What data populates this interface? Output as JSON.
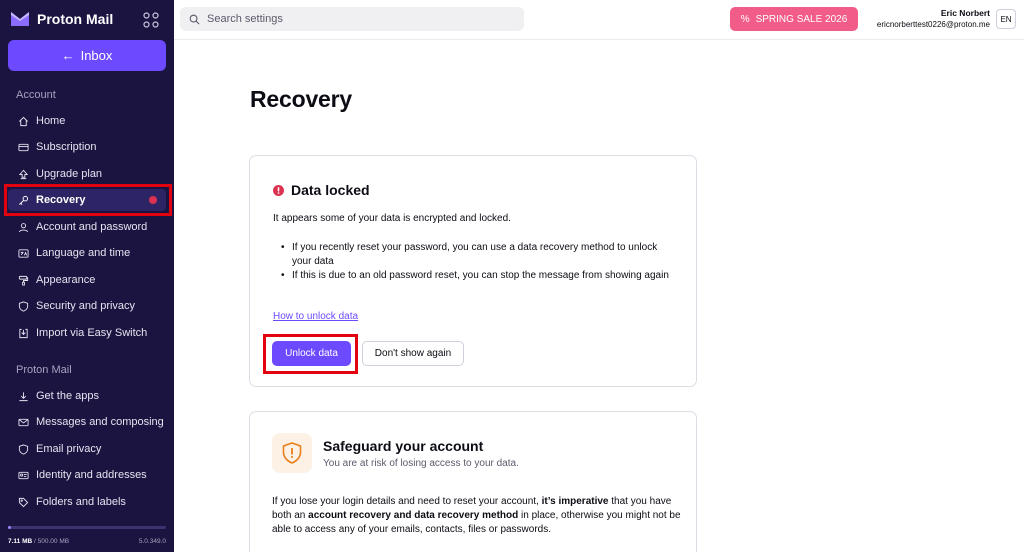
{
  "brand": {
    "name": "Proton Mail"
  },
  "sidebar": {
    "inbox_label": "Inbox",
    "section_account": "Account",
    "account_items": [
      {
        "label": "Home",
        "icon": "home-icon"
      },
      {
        "label": "Subscription",
        "icon": "credit-card-icon"
      },
      {
        "label": "Upgrade plan",
        "icon": "upgrade-arrow-icon"
      },
      {
        "label": "Recovery",
        "icon": "key-icon",
        "active": true,
        "dot": true
      },
      {
        "label": "Account and password",
        "icon": "user-icon"
      },
      {
        "label": "Language and time",
        "icon": "language-icon"
      },
      {
        "label": "Appearance",
        "icon": "paint-roller-icon"
      },
      {
        "label": "Security and privacy",
        "icon": "shield-icon"
      },
      {
        "label": "Import via Easy Switch",
        "icon": "import-icon"
      }
    ],
    "section_mail": "Proton Mail",
    "mail_items": [
      {
        "label": "Get the apps",
        "icon": "download-icon"
      },
      {
        "label": "Messages and composing",
        "icon": "envelope-icon"
      },
      {
        "label": "Email privacy",
        "icon": "shield-icon"
      },
      {
        "label": "Identity and addresses",
        "icon": "id-card-icon"
      },
      {
        "label": "Folders and labels",
        "icon": "tag-icon"
      }
    ],
    "storage_used": "7.11 MB",
    "storage_total": "/ 500.00 MB",
    "storage_fraction": 0.014,
    "version": "5.0.349.0"
  },
  "topbar": {
    "search_placeholder": "Search settings",
    "sale_label": "SPRING SALE 2026",
    "user_name": "Eric Norbert",
    "user_email": "ericnorberttest0226@proton.me",
    "language": "EN"
  },
  "page": {
    "title": "Recovery"
  },
  "data_locked": {
    "title": "Data locked",
    "intro": "It appears some of your data is encrypted and locked.",
    "bullets": [
      "If you recently reset your password, you can use a data recovery method to unlock your data",
      "If this is due to an old password reset, you can stop the message from showing again"
    ],
    "link": "How to unlock data",
    "unlock_label": "Unlock data",
    "dismiss_label": "Don't show again"
  },
  "safeguard": {
    "title": "Safeguard your account",
    "subtitle": "You are at risk of losing access to your data.",
    "text_1": "If you lose your login details and need to reset your account, ",
    "text_bold_1": "it’s imperative",
    "text_2": " that you have both an ",
    "text_bold_2": "account recovery and data recovery method",
    "text_3": " in place, otherwise you might not be able to access any of your emails, contacts, files or passwords."
  },
  "colors": {
    "accent": "#6d4aff",
    "sidebar_bg": "#1b1340",
    "sale": "#f25c88",
    "alert": "#dc3251",
    "highlight": "#e3000f"
  }
}
